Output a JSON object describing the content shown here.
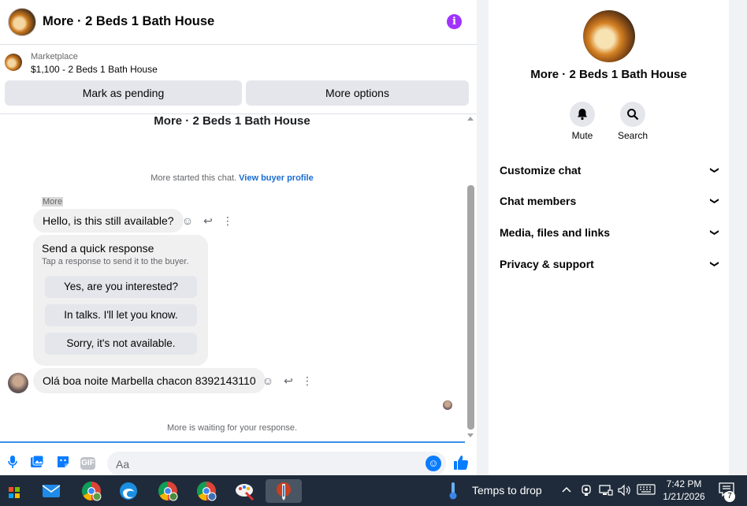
{
  "header": {
    "title": "More · 2 Beds 1 Bath House",
    "info_icon": "i"
  },
  "marketplace": {
    "source": "Marketplace",
    "listing": "$1,100 - 2 Beds 1 Bath House",
    "mark_pending": "Mark as pending",
    "more_options": "More options"
  },
  "messages": {
    "conversation_title": "More · 2 Beds 1 Bath House",
    "started_text": "More started this chat.",
    "buyer_profile_link": "View buyer profile",
    "sender_name": "More",
    "message1": "Hello, is this still available?",
    "quick_response": {
      "heading": "Send a quick response",
      "subtext": "Tap a response to send it to the buyer.",
      "options": [
        "Yes, are you interested?",
        "In talks. I'll let you know.",
        "Sorry, it's not available."
      ]
    },
    "message2": "Olá boa noite Marbella chacon 8392143110",
    "waiting_text": "More is waiting for your response."
  },
  "composer": {
    "placeholder": "Aa",
    "gif_label": "GIF"
  },
  "details": {
    "title": "More · 2 Beds 1 Bath House",
    "mute_label": "Mute",
    "search_label": "Search",
    "sections": [
      "Customize chat",
      "Chat members",
      "Media, files and links",
      "Privacy & support"
    ]
  },
  "taskbar": {
    "weather": "Temps to drop",
    "time": "7:42 PM",
    "date": "1/21/2026",
    "notification_count": "7"
  },
  "colors": {
    "accent": "#0a7cff",
    "info": "#a033ff",
    "link": "#1a6dd4",
    "taskbar": "#1f2b3a"
  }
}
